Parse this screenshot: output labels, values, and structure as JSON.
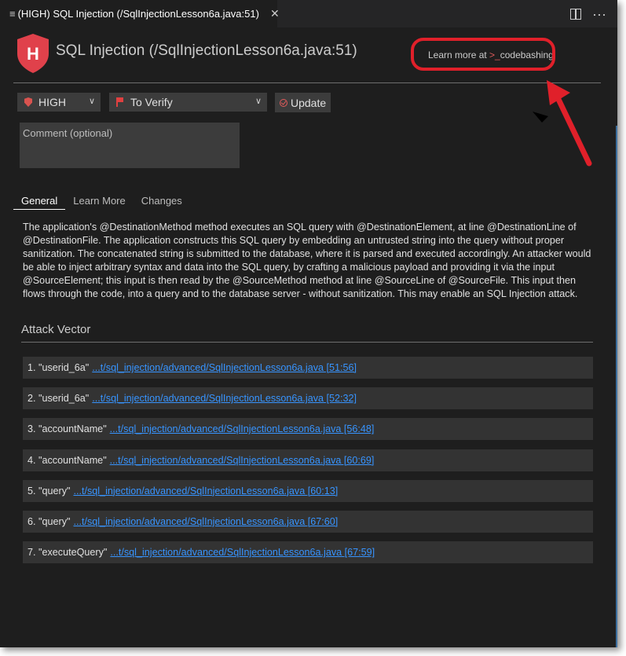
{
  "tab": {
    "icon": "list-icon",
    "title": "(HIGH) SQL Injection (/SqlInjectionLesson6a.java:51)",
    "close_label": "✕"
  },
  "header": {
    "badge_letter": "H",
    "title": "SQL Injection (/SqlInjectionLesson6a.java:51)",
    "learn_more_prefix": "Learn more at ",
    "learn_more_prompt": ">_",
    "learn_more_brand": "codebashing"
  },
  "controls": {
    "severity": "HIGH",
    "state": "To Verify",
    "update_label": "Update",
    "comment_placeholder": "Comment (optional)"
  },
  "tabs": [
    "General",
    "Learn More",
    "Changes"
  ],
  "description": "The application's @DestinationMethod method executes an SQL query with @DestinationElement, at line @DestinationLine of @DestinationFile. The application constructs this SQL query by embedding an untrusted string into the query without proper sanitization. The concatenated string is submitted to the database, where it is parsed and executed accordingly. An attacker would be able to inject arbitrary syntax and data into the SQL query, by crafting a malicious payload and providing it via the input @SourceElement; this input is then read by the @SourceMethod method at line @SourceLine of @SourceFile. This input then flows through the code, into a query and to the database server - without sanitization. This may enable an SQL Injection attack.",
  "attack_vector": {
    "title": "Attack Vector",
    "items": [
      {
        "num": "1.",
        "name": "\"userid_6a\"",
        "link": "...t/sql_injection/advanced/SqlInjectionLesson6a.java [51:56]"
      },
      {
        "num": "2.",
        "name": "\"userid_6a\"",
        "link": "...t/sql_injection/advanced/SqlInjectionLesson6a.java [52:32]"
      },
      {
        "num": "3.",
        "name": "\"accountName\"",
        "link": "...t/sql_injection/advanced/SqlInjectionLesson6a.java [56:48]"
      },
      {
        "num": "4.",
        "name": "\"accountName\"",
        "link": "...t/sql_injection/advanced/SqlInjectionLesson6a.java [60:69]"
      },
      {
        "num": "5.",
        "name": "\"query\"",
        "link": "...t/sql_injection/advanced/SqlInjectionLesson6a.java [60:13]"
      },
      {
        "num": "6.",
        "name": "\"query\"",
        "link": "...t/sql_injection/advanced/SqlInjectionLesson6a.java [67:60]"
      },
      {
        "num": "7.",
        "name": "\"executeQuery\"",
        "link": "...t/sql_injection/advanced/SqlInjectionLesson6a.java [67:59]"
      }
    ]
  },
  "colors": {
    "background": "#1e1e1e",
    "severity_red": "#e0414b",
    "link": "#3794ff",
    "annotation_red": "#e0202a"
  }
}
